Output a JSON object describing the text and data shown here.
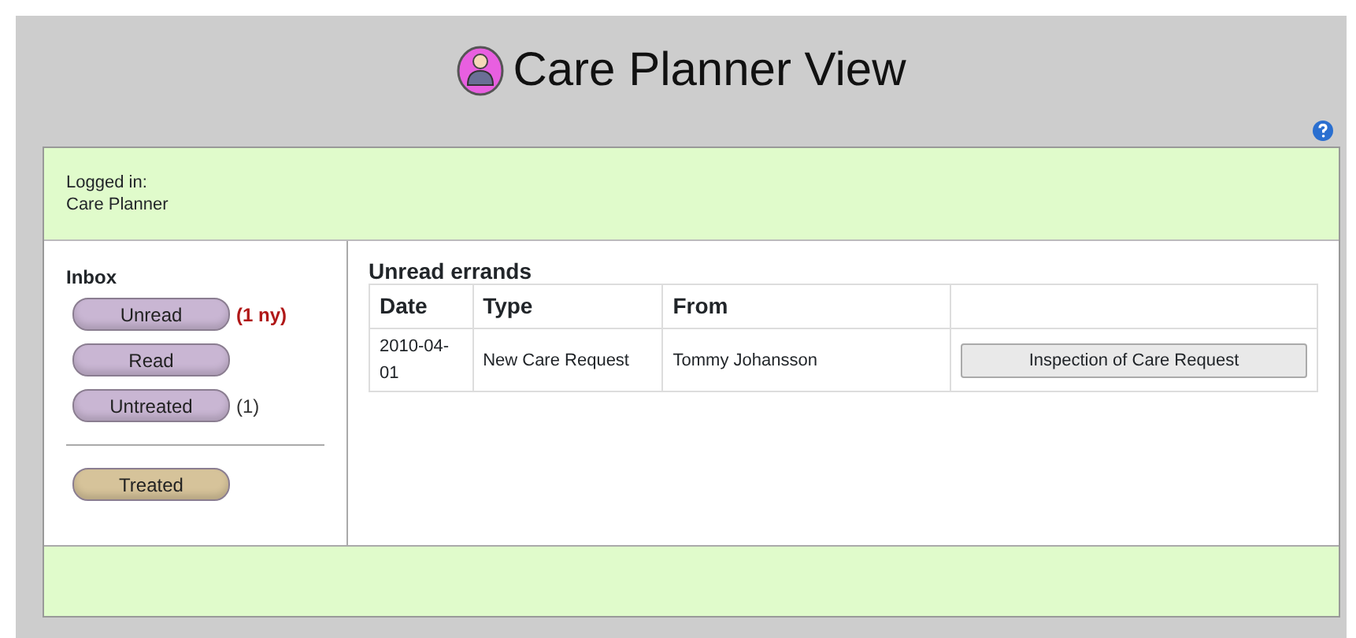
{
  "title": "Care Planner View",
  "login": {
    "label": "Logged in:",
    "user": "Care Planner"
  },
  "inbox": {
    "heading": "Inbox",
    "buttons": [
      {
        "label": "Unread",
        "count": {
          "text": "(1 ny)",
          "color": "#b01818"
        },
        "color": "#c9b6d3"
      },
      {
        "label": "Read",
        "color": "#c9b6d3"
      },
      {
        "label": "Untreated",
        "count": {
          "text": "(1)",
          "color": "#333333"
        },
        "color": "#c9b6d3"
      }
    ],
    "archive_buttons": [
      {
        "label": "Treated",
        "color": "#d6c39a"
      }
    ]
  },
  "errands": {
    "heading": "Unread errands",
    "columns": [
      "Date",
      "Type",
      "From"
    ],
    "rows": [
      {
        "date": "2010-04-01",
        "type": "New Care Request",
        "from": "Tommy Johansson",
        "action": "Inspection of Care Request"
      }
    ]
  }
}
